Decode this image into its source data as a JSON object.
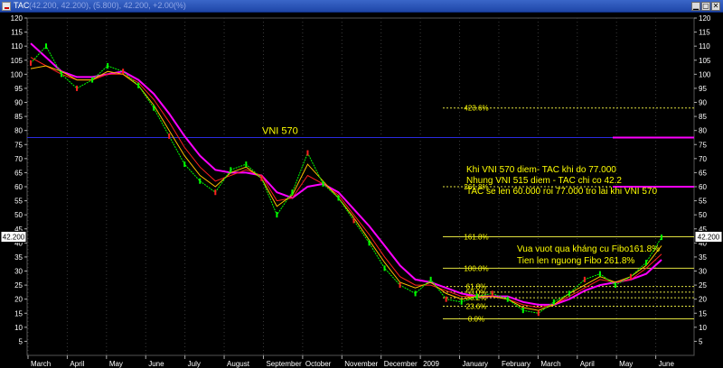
{
  "window": {
    "title": "TAC",
    "quote_text": "(42.200, 42.200), (5.800), 42.200, +2.00(%)",
    "controls": {
      "minimize": "▁",
      "maximize": "▢",
      "close": "✕"
    }
  },
  "colors": {
    "background": "#000000",
    "titlebar": "#2b56bd",
    "grid": "#3a3a3a",
    "price": "#00ff00",
    "ma_fast": "#ffbf00",
    "ma_mid": "#ff2020",
    "ma_slow": "#ff00ff",
    "vni_line": "#2a2ae0",
    "fib": "#e0e040",
    "annotation": "#ffff00",
    "label_box": "#ffffff"
  },
  "chart_data": {
    "type": "line",
    "title": "TAC",
    "ylim": [
      0,
      120
    ],
    "y_ticks": [
      5,
      10,
      15,
      20,
      25,
      30,
      35,
      40,
      45,
      50,
      55,
      60,
      65,
      70,
      75,
      80,
      85,
      90,
      95,
      100,
      105,
      110,
      115,
      120
    ],
    "x_tick_labels": [
      "March",
      "April",
      "May",
      "June",
      "July",
      "August",
      "September",
      "October",
      "November",
      "December",
      "2009",
      "January",
      "February",
      "March",
      "April",
      "May",
      "June"
    ],
    "price_label": "42.200",
    "series": [
      {
        "key": "price",
        "values": [
          104,
          110,
          100,
          95,
          98,
          103,
          101,
          96,
          88,
          78,
          68,
          62,
          58,
          66,
          68,
          63,
          50,
          58,
          72,
          61,
          56,
          48,
          40,
          31,
          25,
          22,
          27,
          20,
          19,
          21,
          22,
          20,
          16,
          15,
          19,
          22,
          27,
          29,
          25,
          28,
          33,
          42
        ]
      },
      {
        "key": "ma_fast",
        "values": [
          102,
          103,
          101,
          98,
          98,
          101,
          100,
          96,
          89,
          80,
          71,
          64,
          60,
          65,
          67,
          63,
          53,
          57,
          68,
          62,
          56,
          49,
          41,
          33,
          26,
          24,
          26,
          22,
          20,
          21,
          21,
          20,
          17,
          16,
          18,
          22,
          25,
          28,
          26,
          28,
          32,
          39
        ]
      },
      {
        "key": "ma_mid",
        "values": [
          106,
          103,
          100,
          98,
          98,
          100,
          100,
          97,
          91,
          83,
          74,
          67,
          62,
          64,
          66,
          64,
          55,
          56,
          64,
          61,
          57,
          50,
          43,
          35,
          28,
          25,
          25,
          23,
          21,
          21,
          21,
          20,
          18,
          17,
          18,
          21,
          24,
          27,
          26,
          27,
          31,
          36
        ]
      },
      {
        "key": "ma_slow",
        "values": [
          111,
          106,
          101,
          99,
          99,
          100,
          101,
          98,
          93,
          86,
          78,
          71,
          66,
          65,
          65,
          64,
          58,
          56,
          60,
          61,
          58,
          52,
          46,
          39,
          32,
          27,
          26,
          24,
          22,
          21,
          21,
          21,
          19,
          18,
          18,
          20,
          23,
          25,
          26,
          27,
          29,
          34
        ]
      }
    ],
    "vni_line": {
      "label": "VNI 570",
      "value": 77.5
    },
    "fibonacci": [
      {
        "label": "423.6%",
        "value": 88
      },
      {
        "label": "261.8%",
        "value": 60
      },
      {
        "label": "161.8%",
        "value": 42.2
      },
      {
        "label": "100.0%",
        "value": 31
      },
      {
        "label": "61.8%",
        "value": 24.5
      },
      {
        "label": "50.0%",
        "value": 22.5
      },
      {
        "label": "38.2%",
        "value": 20.5
      },
      {
        "label": "23.6%",
        "value": 17.5
      },
      {
        "label": "0.0%",
        "value": 13
      }
    ],
    "annotations": [
      "Khi VNI 570 diem- TAC khi do 77.000",
      "Nhung VNI 515 diem - TAC chi co 42.2",
      "TAC se len 60.000 roi 77.000  tro lai khi VNI 570",
      "Vua vuot qua kháng cu Fibo161.8%",
      "Tien len nguong Fibo 261.8%"
    ]
  }
}
